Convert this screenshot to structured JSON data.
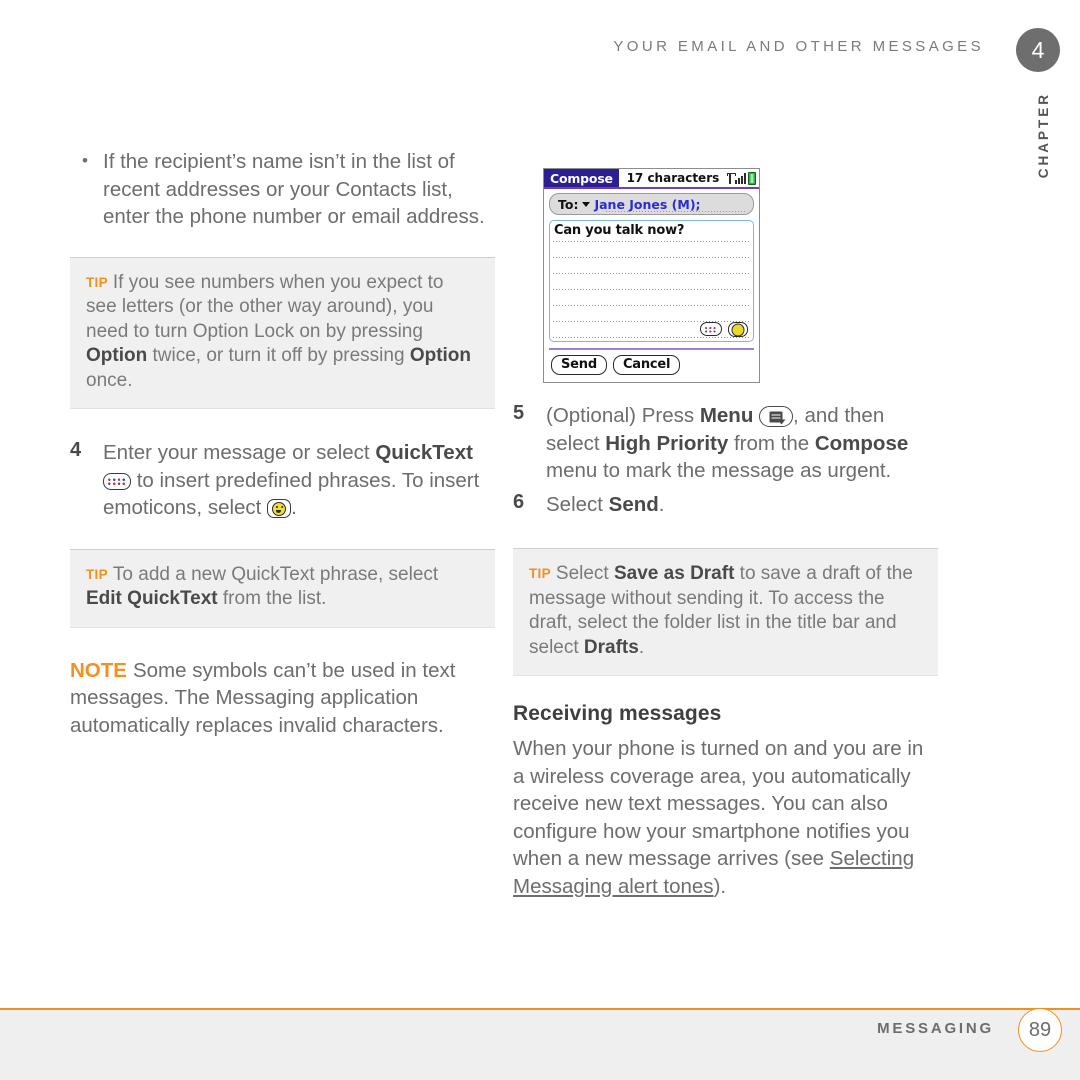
{
  "header": {
    "running_head": "YOUR EMAIL AND OTHER MESSAGES",
    "chapter_number": "4",
    "chapter_word": "CHAPTER"
  },
  "left_column": {
    "bullet": "If the recipient’s name isn’t in the list of recent addresses or your Contacts list, enter the phone number or email address.",
    "tip1": {
      "label": "TIP",
      "part1": "If you see numbers when you expect to see letters (or the other way around), you need to turn Option Lock on by pressing ",
      "bold1": "Option",
      "part2": " twice, or turn it off by pressing ",
      "bold2": "Option",
      "part3": " once."
    },
    "step4": {
      "number": "4",
      "part1": "Enter your message or select ",
      "bold1": "QuickText",
      "icon1": "quicktext-icon",
      "part2": " to insert predefined phrases. To insert emoticons, select ",
      "icon2": "emoticon-icon",
      "part3": "."
    },
    "tip2": {
      "label": "TIP",
      "part1": "To add a new QuickText phrase, select ",
      "bold1": "Edit QuickText",
      "part2": " from the list."
    },
    "note": {
      "label": "NOTE",
      "text": "Some symbols can’t be used in text messages. The Messaging application automatically replaces invalid characters."
    }
  },
  "device": {
    "title_tab": "Compose",
    "title_center": "17 characters",
    "signal_icon": "signal-strength-icon",
    "battery_icon": "battery-icon",
    "to_label": "To:",
    "to_caret": "chevron-down-icon",
    "to_value": "Jane Jones (M);",
    "message_text": "Can you talk now?",
    "quicktext_icon": "quicktext-icon",
    "emoticon_icon": "emoticon-icon",
    "send_button": "Send",
    "cancel_button": "Cancel"
  },
  "right_column": {
    "step5": {
      "number": "5",
      "part1": "(Optional)  Press ",
      "bold1": "Menu",
      "icon1": "menu-icon",
      "part2": ", and then select ",
      "bold2": "High Priority",
      "part3": " from the ",
      "bold3": "Compose",
      "part4": " menu to mark the message as urgent."
    },
    "step6": {
      "number": "6",
      "part1": "Select ",
      "bold1": "Send",
      "part2": "."
    },
    "tip3": {
      "label": "TIP",
      "part1": "Select ",
      "bold1": "Save as Draft",
      "part2": " to save a draft of the message without sending it. To access the draft, select the folder list in the title bar and select ",
      "bold2": "Drafts",
      "part3": "."
    },
    "subhead": "Receiving messages",
    "paragraph_part1": "When your phone is turned on and you are in a wireless coverage area, you automatically receive new text messages. You can also configure how your smartphone notifies you when a new message arrives (see ",
    "paragraph_link": "Selecting Messaging alert tones",
    "paragraph_part2": ")."
  },
  "footer": {
    "section": "MESSAGING",
    "page_number": "89",
    "rule_color": "#f0911e"
  }
}
